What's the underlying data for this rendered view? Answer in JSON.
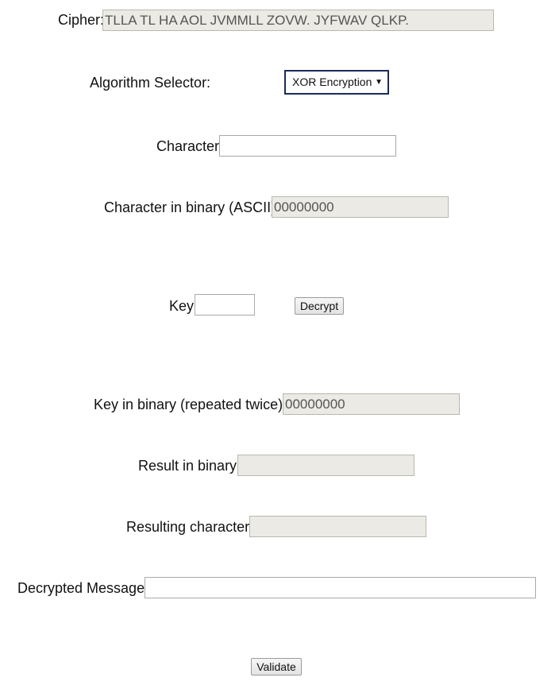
{
  "cipher": {
    "label": "Cipher:",
    "value": "TLLA TL HA AOL JVMMLL ZOVW. JYFWAV QLKP."
  },
  "algorithm": {
    "label": "Algorithm Selector:",
    "selected": "XOR Encryption"
  },
  "character": {
    "label": "Character:",
    "value": ""
  },
  "character_binary": {
    "label": "Character in binary (ASCII):",
    "value": "00000000"
  },
  "key": {
    "label": "Key:",
    "value": ""
  },
  "decrypt_button": "Decrypt",
  "key_binary": {
    "label": "Key in binary (repeated twice):",
    "value": "00000000"
  },
  "result_binary": {
    "label": "Result in binary:",
    "value": ""
  },
  "resulting_character": {
    "label": "Resulting character:",
    "value": ""
  },
  "decrypted_message": {
    "label": "Decrypted Message:",
    "value": ""
  },
  "validate_button": "Validate"
}
